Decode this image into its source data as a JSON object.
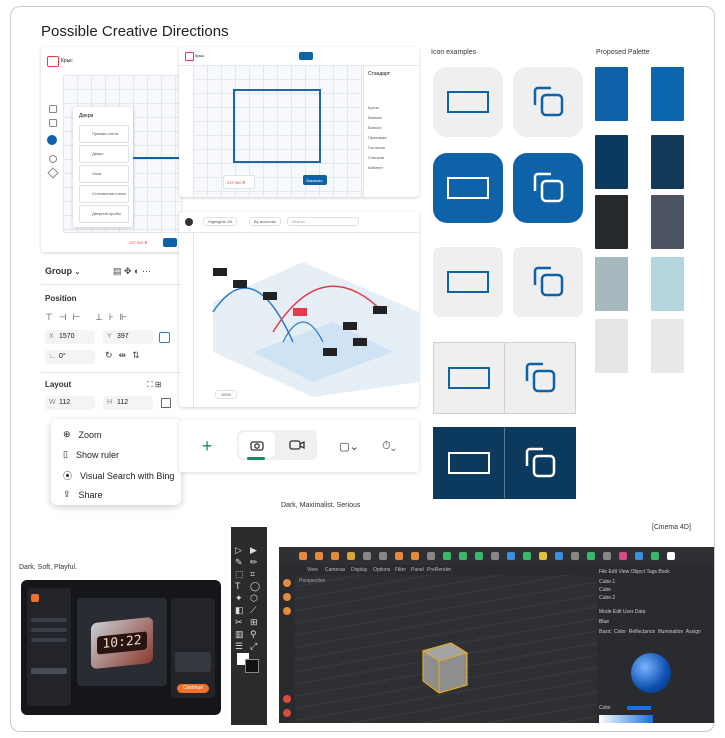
{
  "board_title": "Possible Creative Directions",
  "section_labels": {
    "icon_examples": "Icon examples",
    "palette": "Proposed Palette",
    "dark_maximalist": "Dark, Maximalist, Serious",
    "dark_soft": "Dark, Soft, Playful.",
    "cinema4d": "[Cinema 4D]"
  },
  "mockup1": {
    "brand": "Крыс",
    "list_title": "Двери",
    "items": [
      "Прямая стена",
      "Двери",
      "Окна",
      "Стеклянная стена",
      "Дверной проём"
    ],
    "price": "237 900 ₽"
  },
  "mockup2": {
    "brand": "Крыс",
    "panel_title": "Стандарт",
    "panel_rows": [
      "Кухня",
      "Ванная",
      "Балкон",
      "Прихожая",
      "Гостиная",
      "Спальня",
      "Кабинет"
    ],
    "price": "237 900 ₽",
    "cta": "Заказать"
  },
  "mockup3": {
    "highlights": "Highlights 2/5",
    "group": "By accounts",
    "search_placeholder": "Search",
    "zoom": "100%"
  },
  "props": {
    "group_label": "Group",
    "position_title": "Position",
    "x_label": "X",
    "x_value": "1570",
    "y_label": "Y",
    "y_value": "397",
    "rot_value": "0°",
    "layout_title": "Layout",
    "w_label": "W",
    "w_value": "112",
    "h_label": "H",
    "h_value": "112"
  },
  "context_menu": {
    "items": [
      "Zoom",
      "Show ruler",
      "Visual Search with Bing",
      "Share"
    ]
  },
  "toolbar": {
    "add": "+"
  },
  "palette": {
    "left": [
      "#0e62a8",
      "#0b3a5e",
      "#26292c",
      "#a8b8bf",
      "#e4e6e8"
    ],
    "right": [
      "#0d66b0",
      "#133a58",
      "#4d5461",
      "#b5d5dc",
      "#e8e9ea"
    ]
  },
  "colors": {
    "accent": "#0e62a8",
    "navy": "#0b3a5e",
    "tile_light": "#efeff0"
  },
  "c4d": {
    "menu": [
      "View",
      "Cameras",
      "Display",
      "Options",
      "Filter",
      "Panel",
      "ProRender"
    ],
    "viewport_label": "Perspective",
    "obj_menu": [
      "File",
      "Edit",
      "View",
      "Object",
      "Tags",
      "Book"
    ],
    "objects": [
      "Cube.1",
      "Cube",
      "Cube.2"
    ],
    "attr_menu": [
      "Mode",
      "Edit",
      "User Data"
    ],
    "material_name": "Blue",
    "tabs": [
      "Basic",
      "Color",
      "Reflectance",
      "Illumination",
      "Assign"
    ],
    "color_label": "Color"
  },
  "soft": {
    "clock": "10:22",
    "cta": "Continue"
  }
}
